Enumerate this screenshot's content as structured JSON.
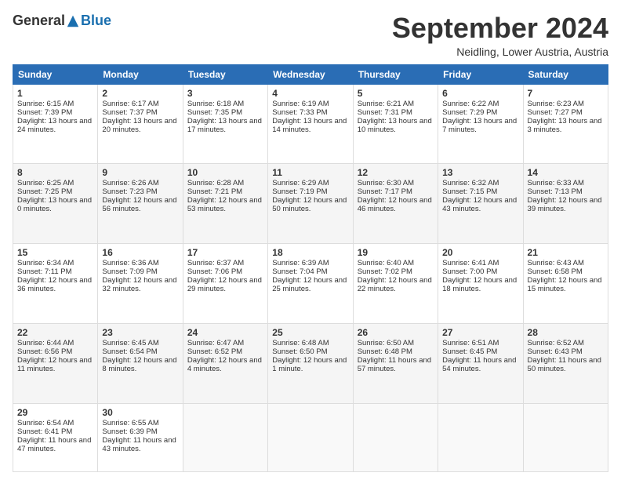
{
  "logo": {
    "general": "General",
    "blue": "Blue"
  },
  "header": {
    "month": "September 2024",
    "location": "Neidling, Lower Austria, Austria"
  },
  "days": [
    "Sunday",
    "Monday",
    "Tuesday",
    "Wednesday",
    "Thursday",
    "Friday",
    "Saturday"
  ],
  "weeks": [
    [
      {
        "day": "1",
        "sunrise": "6:15 AM",
        "sunset": "7:39 PM",
        "daylight": "13 hours and 24 minutes."
      },
      {
        "day": "2",
        "sunrise": "6:17 AM",
        "sunset": "7:37 PM",
        "daylight": "13 hours and 20 minutes."
      },
      {
        "day": "3",
        "sunrise": "6:18 AM",
        "sunset": "7:35 PM",
        "daylight": "13 hours and 17 minutes."
      },
      {
        "day": "4",
        "sunrise": "6:19 AM",
        "sunset": "7:33 PM",
        "daylight": "13 hours and 14 minutes."
      },
      {
        "day": "5",
        "sunrise": "6:21 AM",
        "sunset": "7:31 PM",
        "daylight": "13 hours and 10 minutes."
      },
      {
        "day": "6",
        "sunrise": "6:22 AM",
        "sunset": "7:29 PM",
        "daylight": "13 hours and 7 minutes."
      },
      {
        "day": "7",
        "sunrise": "6:23 AM",
        "sunset": "7:27 PM",
        "daylight": "13 hours and 3 minutes."
      }
    ],
    [
      {
        "day": "8",
        "sunrise": "6:25 AM",
        "sunset": "7:25 PM",
        "daylight": "13 hours and 0 minutes."
      },
      {
        "day": "9",
        "sunrise": "6:26 AM",
        "sunset": "7:23 PM",
        "daylight": "12 hours and 56 minutes."
      },
      {
        "day": "10",
        "sunrise": "6:28 AM",
        "sunset": "7:21 PM",
        "daylight": "12 hours and 53 minutes."
      },
      {
        "day": "11",
        "sunrise": "6:29 AM",
        "sunset": "7:19 PM",
        "daylight": "12 hours and 50 minutes."
      },
      {
        "day": "12",
        "sunrise": "6:30 AM",
        "sunset": "7:17 PM",
        "daylight": "12 hours and 46 minutes."
      },
      {
        "day": "13",
        "sunrise": "6:32 AM",
        "sunset": "7:15 PM",
        "daylight": "12 hours and 43 minutes."
      },
      {
        "day": "14",
        "sunrise": "6:33 AM",
        "sunset": "7:13 PM",
        "daylight": "12 hours and 39 minutes."
      }
    ],
    [
      {
        "day": "15",
        "sunrise": "6:34 AM",
        "sunset": "7:11 PM",
        "daylight": "12 hours and 36 minutes."
      },
      {
        "day": "16",
        "sunrise": "6:36 AM",
        "sunset": "7:09 PM",
        "daylight": "12 hours and 32 minutes."
      },
      {
        "day": "17",
        "sunrise": "6:37 AM",
        "sunset": "7:06 PM",
        "daylight": "12 hours and 29 minutes."
      },
      {
        "day": "18",
        "sunrise": "6:39 AM",
        "sunset": "7:04 PM",
        "daylight": "12 hours and 25 minutes."
      },
      {
        "day": "19",
        "sunrise": "6:40 AM",
        "sunset": "7:02 PM",
        "daylight": "12 hours and 22 minutes."
      },
      {
        "day": "20",
        "sunrise": "6:41 AM",
        "sunset": "7:00 PM",
        "daylight": "12 hours and 18 minutes."
      },
      {
        "day": "21",
        "sunrise": "6:43 AM",
        "sunset": "6:58 PM",
        "daylight": "12 hours and 15 minutes."
      }
    ],
    [
      {
        "day": "22",
        "sunrise": "6:44 AM",
        "sunset": "6:56 PM",
        "daylight": "12 hours and 11 minutes."
      },
      {
        "day": "23",
        "sunrise": "6:45 AM",
        "sunset": "6:54 PM",
        "daylight": "12 hours and 8 minutes."
      },
      {
        "day": "24",
        "sunrise": "6:47 AM",
        "sunset": "6:52 PM",
        "daylight": "12 hours and 4 minutes."
      },
      {
        "day": "25",
        "sunrise": "6:48 AM",
        "sunset": "6:50 PM",
        "daylight": "12 hours and 1 minute."
      },
      {
        "day": "26",
        "sunrise": "6:50 AM",
        "sunset": "6:48 PM",
        "daylight": "11 hours and 57 minutes."
      },
      {
        "day": "27",
        "sunrise": "6:51 AM",
        "sunset": "6:45 PM",
        "daylight": "11 hours and 54 minutes."
      },
      {
        "day": "28",
        "sunrise": "6:52 AM",
        "sunset": "6:43 PM",
        "daylight": "11 hours and 50 minutes."
      }
    ],
    [
      {
        "day": "29",
        "sunrise": "6:54 AM",
        "sunset": "6:41 PM",
        "daylight": "11 hours and 47 minutes."
      },
      {
        "day": "30",
        "sunrise": "6:55 AM",
        "sunset": "6:39 PM",
        "daylight": "11 hours and 43 minutes."
      },
      null,
      null,
      null,
      null,
      null
    ]
  ]
}
